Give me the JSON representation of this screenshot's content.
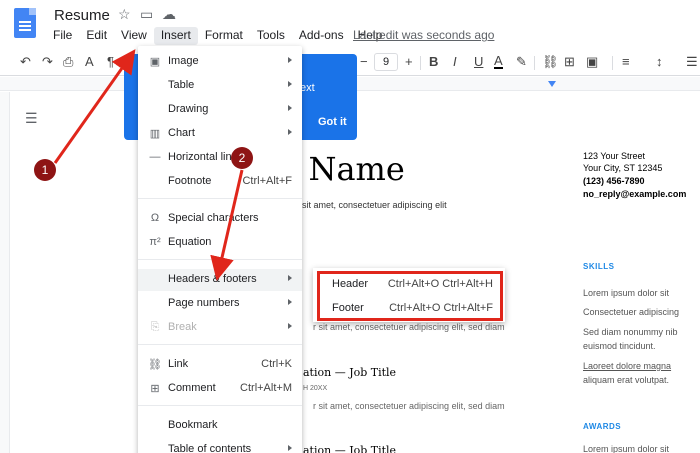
{
  "window": {
    "title": "Resume",
    "last_edit": "Last edit was seconds ago"
  },
  "menubar": [
    "File",
    "Edit",
    "View",
    "Insert",
    "Format",
    "Tools",
    "Add-ons",
    "Help"
  ],
  "toolbar": {
    "font_size": "9"
  },
  "tooltip": {
    "text": "ext",
    "button": "Got it"
  },
  "insert_menu": {
    "items": [
      {
        "label": "Image",
        "icon": "image-icon",
        "glyph": "▣",
        "submenu": true
      },
      {
        "label": "Table",
        "icon": "",
        "glyph": "",
        "submenu": true
      },
      {
        "label": "Drawing",
        "icon": "",
        "glyph": "",
        "submenu": true
      },
      {
        "label": "Chart",
        "icon": "chart-icon",
        "glyph": "▥",
        "submenu": true
      },
      {
        "label": "Horizontal line",
        "icon": "horizontal-line-icon",
        "glyph": "—",
        "submenu": false
      },
      {
        "label": "Footnote",
        "icon": "",
        "glyph": "",
        "shortcut": "Ctrl+Alt+F"
      },
      {
        "label": "Special characters",
        "icon": "omega-icon",
        "glyph": "Ω"
      },
      {
        "label": "Equation",
        "icon": "equation-icon",
        "glyph": "π²"
      },
      {
        "label": "Headers & footers",
        "icon": "",
        "glyph": "",
        "submenu": true,
        "hover": true
      },
      {
        "label": "Page numbers",
        "icon": "",
        "glyph": "",
        "submenu": true
      },
      {
        "label": "Break",
        "icon": "break-icon",
        "glyph": "⎘",
        "submenu": true,
        "disabled": true
      },
      {
        "label": "Link",
        "icon": "link-icon",
        "glyph": "⛓",
        "shortcut": "Ctrl+K"
      },
      {
        "label": "Comment",
        "icon": "comment-icon",
        "glyph": "⊞",
        "shortcut": "Ctrl+Alt+M"
      },
      {
        "label": "Bookmark",
        "icon": "",
        "glyph": ""
      },
      {
        "label": "Table of contents",
        "icon": "",
        "glyph": "",
        "submenu": true
      }
    ]
  },
  "headers_submenu": {
    "items": [
      {
        "label": "Header",
        "shortcut": "Ctrl+Alt+O Ctrl+Alt+H"
      },
      {
        "label": "Footer",
        "shortcut": "Ctrl+Alt+O Ctrl+Alt+F"
      }
    ]
  },
  "document": {
    "name": "r Name",
    "intro": "sit amet, consectetuer adipiscing elit",
    "line1": "r sit amet, consectetuer adipiscing elit, sed diam",
    "section1_title": "ation — Job Title",
    "section1_date": "H 20XX",
    "line2": "r sit amet, consectetuer adipiscing elit, sed diam",
    "section2_title": "ation — Job Title"
  },
  "contact": {
    "street": "123 Your Street",
    "city": "Your City, ST 12345",
    "phone": "(123) 456-7890",
    "email": "no_reply@example.com"
  },
  "right_column": {
    "skills_heading": "SKILLS",
    "skills": [
      "Lorem ipsum dolor sit",
      "Consectetuer adipiscing",
      "Sed diam nonummy nib",
      "euismod tincidunt.",
      "Laoreet dolore magna",
      "aliquam erat volutpat."
    ],
    "awards_heading": "AWARDS",
    "awards": [
      "Lorem ipsum dolor sit"
    ]
  },
  "annotations": {
    "step1": "1",
    "step2": "2"
  },
  "colors": {
    "accent": "#1a73e8",
    "annotation_red": "#e0261b",
    "badge": "#8e1414"
  }
}
